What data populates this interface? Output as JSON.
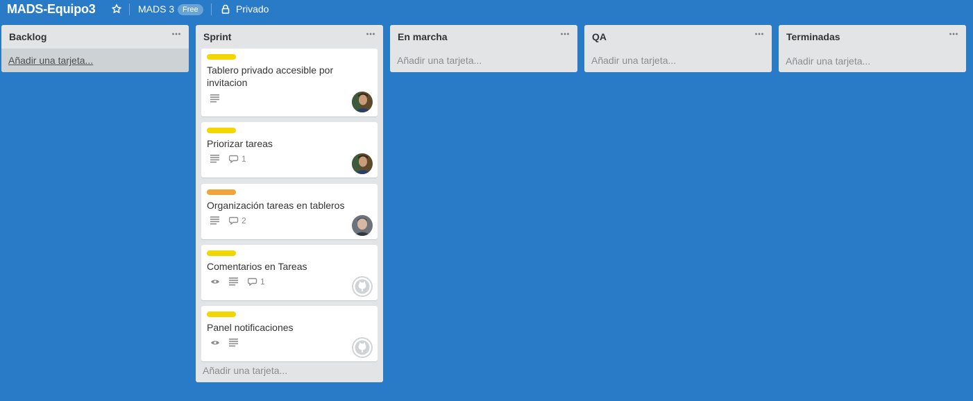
{
  "board": {
    "title": "MADS-Equipo3",
    "team": "MADS 3",
    "plan_badge": "Free",
    "visibility": "Privado",
    "colors": {
      "background": "#2a7bc7",
      "list": "#e2e4e6",
      "label_yellow": "#f2d600",
      "label_orange": "#f2a33a"
    }
  },
  "lists": [
    {
      "title": "Backlog",
      "add_card": "Añadir una tarjeta..."
    },
    {
      "title": "Sprint",
      "add_card": "Añadir una tarjeta...",
      "cards": [
        {
          "label_color": "yellow",
          "title": "Tablero privado accesible por invitacion",
          "icons": [
            "description-icon"
          ],
          "comments": "",
          "avatar": "member-photo-1"
        },
        {
          "label_color": "yellow",
          "title": "Priorizar tareas",
          "icons": [
            "description-icon",
            "comment-icon"
          ],
          "comments": "1",
          "avatar": "member-photo-1"
        },
        {
          "label_color": "orange",
          "title": "Organización tareas en tableros",
          "icons": [
            "description-icon",
            "comment-icon"
          ],
          "comments": "2",
          "avatar": "member-photo-2"
        },
        {
          "label_color": "yellow",
          "title": "Comentarios en Tareas",
          "icons": [
            "watch-icon",
            "description-icon",
            "comment-icon"
          ],
          "comments": "1",
          "avatar": "github-icon"
        },
        {
          "label_color": "yellow",
          "title": "Panel notificaciones",
          "icons": [
            "watch-icon",
            "description-icon"
          ],
          "comments": "",
          "avatar": "github-icon"
        }
      ]
    },
    {
      "title": "En marcha",
      "add_card": "Añadir una tarjeta..."
    },
    {
      "title": "QA",
      "add_card": "Añadir una tarjeta..."
    },
    {
      "title": "Terminadas",
      "add_card": "Añadir una tarjeta..."
    }
  ]
}
